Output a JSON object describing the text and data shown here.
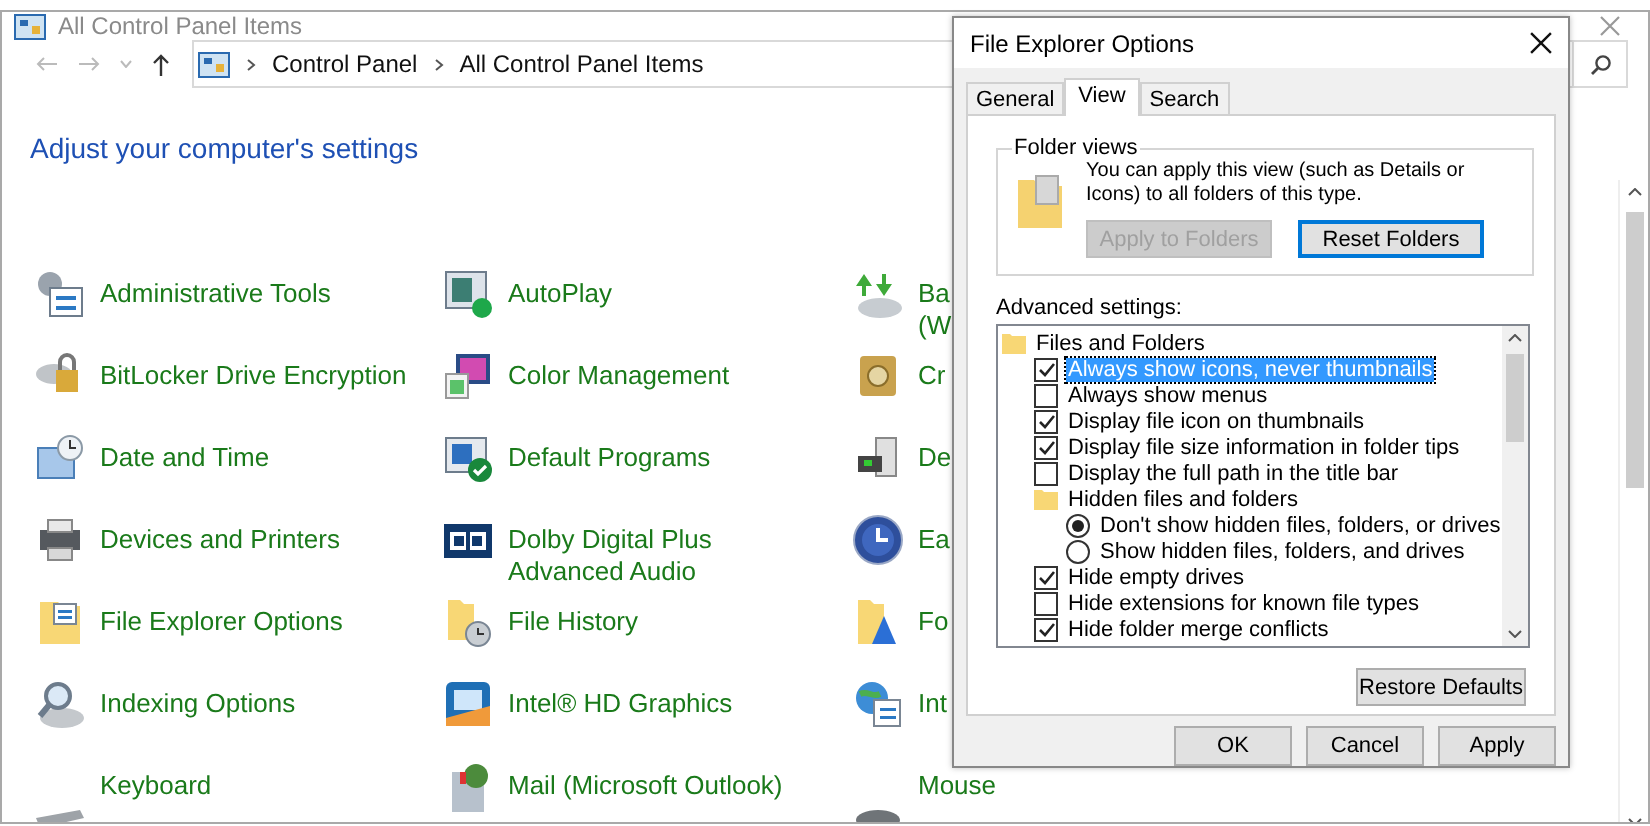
{
  "window": {
    "title": "All Control Panel Items"
  },
  "address_bar": {
    "path": [
      "Control Panel",
      "All Control Panel Items"
    ]
  },
  "heading": "Adjust your computer's settings",
  "items": [
    {
      "lines": [
        "Administrative Tools"
      ]
    },
    {
      "lines": [
        "AutoPlay"
      ]
    },
    {
      "lines": [
        "Ba",
        "(W"
      ]
    },
    {
      "lines": [
        "BitLocker Drive Encryption"
      ]
    },
    {
      "lines": [
        "Color Management"
      ]
    },
    {
      "lines": [
        "Cr"
      ]
    },
    {
      "lines": [
        "Date and Time"
      ]
    },
    {
      "lines": [
        "Default Programs"
      ]
    },
    {
      "lines": [
        "De"
      ]
    },
    {
      "lines": [
        "Devices and Printers"
      ]
    },
    {
      "lines": [
        "Dolby Digital Plus",
        "Advanced Audio"
      ]
    },
    {
      "lines": [
        "Ea"
      ]
    },
    {
      "lines": [
        "File Explorer Options"
      ]
    },
    {
      "lines": [
        "File History"
      ]
    },
    {
      "lines": [
        "Fo"
      ]
    },
    {
      "lines": [
        "Indexing Options"
      ]
    },
    {
      "lines": [
        "Intel® HD Graphics"
      ]
    },
    {
      "lines": [
        "Int"
      ]
    },
    {
      "lines": [
        "Keyboard"
      ]
    },
    {
      "lines": [
        "Mail (Microsoft Outlook)"
      ]
    },
    {
      "lines": [
        "Mouse"
      ]
    }
  ],
  "dialog": {
    "title": "File Explorer Options",
    "tabs": [
      {
        "label": "General",
        "selected": false
      },
      {
        "label": "View",
        "selected": true
      },
      {
        "label": "Search",
        "selected": false
      }
    ],
    "folder_views": {
      "legend": "Folder views",
      "description": "You can apply this view (such as Details or Icons) to all folders of this type.",
      "buttons": [
        {
          "label": "Apply to Folders",
          "disabled": true
        },
        {
          "label": "Reset Folders",
          "disabled": false
        }
      ]
    },
    "advanced_label": "Advanced settings:",
    "tree": [
      {
        "kind": "folder",
        "label": "Files and Folders",
        "selected": false,
        "children": [
          {
            "kind": "checkbox",
            "label": "Always show icons, never thumbnails",
            "checked": true,
            "selected": true
          },
          {
            "kind": "checkbox",
            "label": "Always show menus",
            "checked": false,
            "selected": false
          },
          {
            "kind": "checkbox",
            "label": "Display file icon on thumbnails",
            "checked": true,
            "selected": false
          },
          {
            "kind": "checkbox",
            "label": "Display file size information in folder tips",
            "checked": true,
            "selected": false
          },
          {
            "kind": "checkbox",
            "label": "Display the full path in the title bar",
            "checked": false,
            "selected": false
          },
          {
            "kind": "folder",
            "label": "Hidden files and folders",
            "selected": false,
            "children": [
              {
                "kind": "radio",
                "label": "Don't show hidden files, folders, or drives",
                "checked": true,
                "selected": false
              },
              {
                "kind": "radio",
                "label": "Show hidden files, folders, and drives",
                "checked": false,
                "selected": false
              }
            ]
          },
          {
            "kind": "checkbox",
            "label": "Hide empty drives",
            "checked": true,
            "selected": false
          },
          {
            "kind": "checkbox",
            "label": "Hide extensions for known file types",
            "checked": false,
            "selected": false
          },
          {
            "kind": "checkbox",
            "label": "Hide folder merge conflicts",
            "checked": true,
            "selected": false
          }
        ]
      }
    ],
    "restore_button": "Restore Defaults",
    "buttons": [
      "OK",
      "Cancel",
      "Apply"
    ]
  }
}
